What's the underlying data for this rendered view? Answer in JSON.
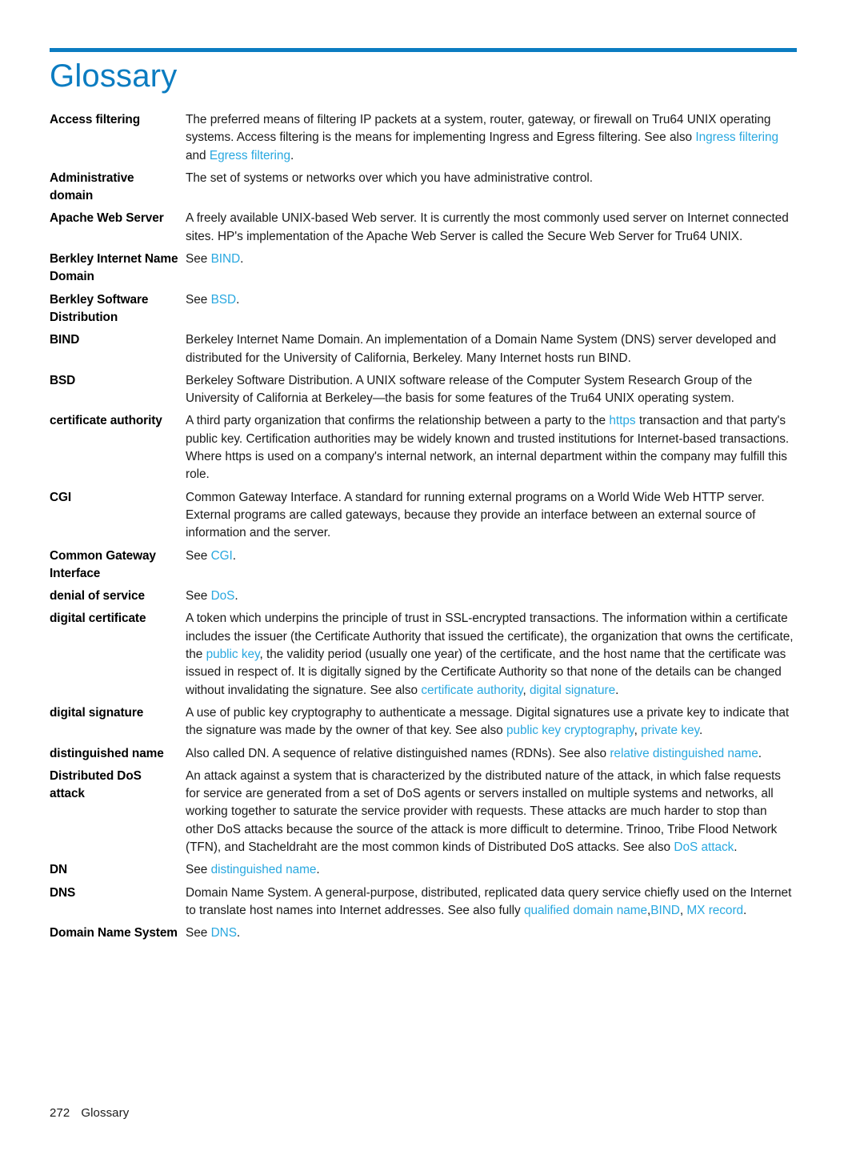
{
  "header": {
    "title": "Glossary",
    "rule_color": "#0b7cc1",
    "title_color": "#0b7cc1"
  },
  "theme": {
    "link_color": "#29a8e0",
    "text_color": "#1a1a1a",
    "background": "#ffffff"
  },
  "glossary": {
    "entries": [
      {
        "term": "Access filtering",
        "parts": [
          {
            "t": "The preferred means of filtering IP packets at a system, router, gateway, or firewall on Tru64 UNIX operating systems. Access filtering is the means for implementing Ingress and Egress filtering. See also ",
            "link": false
          },
          {
            "t": "Ingress filtering",
            "link": true
          },
          {
            "t": " and ",
            "link": false
          },
          {
            "t": "Egress filtering",
            "link": true
          },
          {
            "t": ".",
            "link": false
          }
        ]
      },
      {
        "term": "Administrative domain",
        "parts": [
          {
            "t": "The set of systems or networks over which you have administrative control.",
            "link": false
          }
        ]
      },
      {
        "term": "Apache Web Server",
        "parts": [
          {
            "t": "A freely available UNIX-based Web server. It is currently the most commonly used server on Internet connected sites. HP's implementation of the Apache Web Server is called the Secure Web Server for Tru64 UNIX.",
            "link": false
          }
        ]
      },
      {
        "term": "Berkley Internet Name Domain",
        "parts": [
          {
            "t": "See ",
            "link": false
          },
          {
            "t": "BIND",
            "link": true
          },
          {
            "t": ".",
            "link": false
          }
        ]
      },
      {
        "term": "Berkley Software Distribution",
        "parts": [
          {
            "t": "See ",
            "link": false
          },
          {
            "t": "BSD",
            "link": true
          },
          {
            "t": ".",
            "link": false
          }
        ]
      },
      {
        "term": "BIND",
        "parts": [
          {
            "t": "Berkeley Internet Name Domain. An implementation of a Domain Name System (DNS) server developed and distributed for the University of California, Berkeley. Many Internet hosts run BIND.",
            "link": false
          }
        ]
      },
      {
        "term": "BSD",
        "parts": [
          {
            "t": "Berkeley Software Distribution. A UNIX software release of the Computer System Research Group of the University of California at Berkeley—the basis for some features of the Tru64 UNIX operating system.",
            "link": false
          }
        ]
      },
      {
        "term": "certificate authority",
        "parts": [
          {
            "t": "A third party organization that confirms the relationship between a party to the ",
            "link": false
          },
          {
            "t": "https",
            "link": true
          },
          {
            "t": " transaction and that party's public key. Certification authorities may be widely known and trusted institutions for Internet-based transactions. Where https is used on a company's internal network, an internal department within the company may fulfill this role.",
            "link": false
          }
        ]
      },
      {
        "term": "CGI",
        "parts": [
          {
            "t": "Common Gateway Interface. A standard for running external programs on a World Wide Web HTTP server. External programs are called gateways, because they provide an interface between an external source of information and the server.",
            "link": false
          }
        ]
      },
      {
        "term": "Common Gateway Interface",
        "parts": [
          {
            "t": "See ",
            "link": false
          },
          {
            "t": "CGI",
            "link": true
          },
          {
            "t": ".",
            "link": false
          }
        ]
      },
      {
        "term": "denial of service",
        "parts": [
          {
            "t": "See ",
            "link": false
          },
          {
            "t": "DoS",
            "link": true
          },
          {
            "t": ".",
            "link": false
          }
        ]
      },
      {
        "term": "digital certificate",
        "parts": [
          {
            "t": "A token which underpins the principle of trust in SSL-encrypted transactions. The information within a certificate includes the issuer (the Certificate Authority that issued the certificate), the organization that owns the certificate, the ",
            "link": false
          },
          {
            "t": "public key",
            "link": true
          },
          {
            "t": ", the validity period (usually one year) of the certificate, and the host name that the certificate was issued in respect of. It is digitally signed by the Certificate Authority so that none of the details can be changed without invalidating the signature. See also ",
            "link": false
          },
          {
            "t": "certificate authority",
            "link": true
          },
          {
            "t": ", ",
            "link": false
          },
          {
            "t": "digital signature",
            "link": true
          },
          {
            "t": ".",
            "link": false
          }
        ]
      },
      {
        "term": "digital signature",
        "parts": [
          {
            "t": "A use of public key cryptography to authenticate a message. Digital signatures use a private key to indicate that the signature was made by the owner of that key. See also ",
            "link": false
          },
          {
            "t": "public key cryptography",
            "link": true
          },
          {
            "t": ", ",
            "link": false
          },
          {
            "t": "private key",
            "link": true
          },
          {
            "t": ".",
            "link": false
          }
        ]
      },
      {
        "term": "distinguished name",
        "parts": [
          {
            "t": "Also called DN. A sequence of relative distinguished names (RDNs). See also ",
            "link": false
          },
          {
            "t": "relative distinguished name",
            "link": true
          },
          {
            "t": ".",
            "link": false
          }
        ]
      },
      {
        "term": "Distributed DoS attack",
        "parts": [
          {
            "t": "An attack against a system that is characterized by the distributed nature of the attack, in which false requests for service are generated from a set of DoS agents or servers installed on multiple systems and networks, all working together to saturate the service provider with requests. These attacks are much harder to stop than other DoS attacks because the source of the attack is more difficult to determine. Trinoo, Tribe Flood Network (TFN), and Stacheldraht are the most common kinds of Distributed DoS attacks. See also ",
            "link": false
          },
          {
            "t": "DoS attack",
            "link": true
          },
          {
            "t": ".",
            "link": false
          }
        ]
      },
      {
        "term": "DN",
        "parts": [
          {
            "t": "See ",
            "link": false
          },
          {
            "t": "distinguished name",
            "link": true
          },
          {
            "t": ".",
            "link": false
          }
        ]
      },
      {
        "term": "DNS",
        "parts": [
          {
            "t": "Domain Name System. A general-purpose, distributed, replicated data query service chiefly used on the Internet to translate host names into Internet addresses. See also fully ",
            "link": false
          },
          {
            "t": "qualified domain name",
            "link": true
          },
          {
            "t": ",",
            "link": false
          },
          {
            "t": "BIND",
            "link": true
          },
          {
            "t": ", ",
            "link": false
          },
          {
            "t": "MX record",
            "link": true
          },
          {
            "t": ".",
            "link": false
          }
        ]
      },
      {
        "term": "Domain Name System",
        "parts": [
          {
            "t": "See ",
            "link": false
          },
          {
            "t": "DNS",
            "link": true
          },
          {
            "t": ".",
            "link": false
          }
        ]
      }
    ]
  },
  "footer": {
    "page_number": "272",
    "section": "Glossary"
  }
}
